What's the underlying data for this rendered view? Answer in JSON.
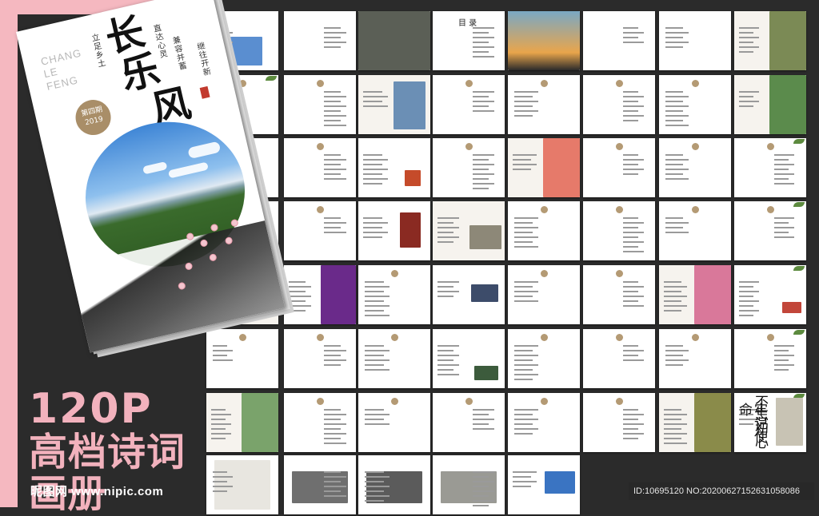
{
  "cover": {
    "brand_lines": [
      "CHANG",
      "LE",
      "FENG"
    ],
    "issue": "第四期",
    "year": "2019",
    "title_chars": [
      "长",
      "乐",
      "风"
    ],
    "mottos": [
      "立足乡土",
      "直达心灵",
      "兼容并蓄",
      "继往开新"
    ]
  },
  "promo": {
    "line1": "120P",
    "line2": "高档诗词",
    "line3": "画册"
  },
  "watermark": "昵图网 www.nipic.com",
  "id_text": "ID:10695120 NO:20200627152631058086",
  "toc_title": "目 录",
  "quote_chars": [
    "不忘初心",
    "牢记使命"
  ],
  "colors": {
    "pink": "#f5b8c0",
    "background": "#2b2b2b",
    "gold": "#a98e68"
  }
}
